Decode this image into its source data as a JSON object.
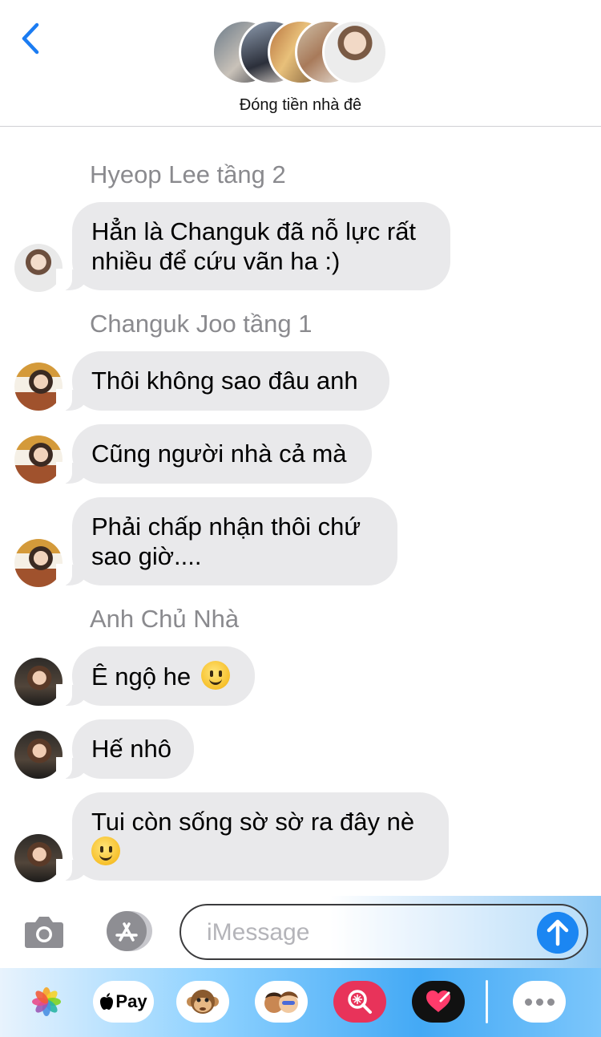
{
  "header": {
    "group_name": "Đóng tiền nhà đê",
    "back_icon": "chevron-left-icon",
    "accent_color": "#1b7cf2"
  },
  "thread": [
    {
      "sender": "Hyeop Lee tầng 2",
      "messages": [
        "Hẳn là Changuk đã nỗ lực rất\nnhiều để cứu vãn ha :)"
      ]
    },
    {
      "sender": "Changuk Joo tầng 1",
      "messages": [
        "Thôi không sao đâu anh",
        "Cũng người nhà cả mà",
        "Phải chấp nhận thôi chứ\nsao giờ...."
      ]
    },
    {
      "sender": "Anh Chủ Nhà",
      "messages": [
        "Ê ngộ he",
        "Hế nhô",
        "Tui còn sống sờ sờ ra đây nè"
      ]
    }
  ],
  "composer": {
    "placeholder": "iMessage",
    "camera_icon": "camera-icon",
    "appstore_icon": "app-store-icon",
    "send_icon": "send-arrow-icon"
  },
  "apps": {
    "pay_label": "Pay",
    "items": [
      "photos-icon",
      "apple-pay-icon",
      "monkey-animoji-icon",
      "memoji-icon",
      "search-images-icon",
      "digital-touch-icon",
      "more-apps-icon"
    ]
  },
  "colors": {
    "bubble": "#e9e9eb",
    "sender_label": "#8a8a8e",
    "send_button": "#1b86f2"
  }
}
